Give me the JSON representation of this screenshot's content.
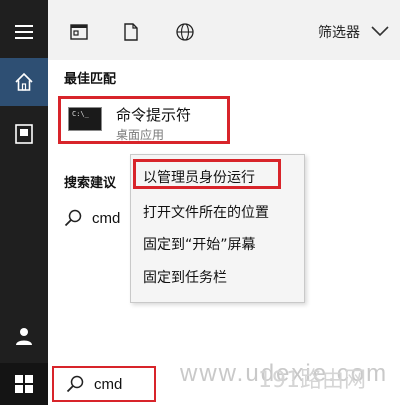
{
  "filter_bar": {
    "filter_label": "筛选器",
    "icons": [
      "apps-icon",
      "document-icon",
      "globe-icon",
      "chevron-down-icon"
    ]
  },
  "rail": {
    "icons": [
      "hamburger-menu-icon",
      "home-icon",
      "documents-icon",
      "user-icon"
    ],
    "accent": "#2e4f73"
  },
  "best_match": {
    "heading": "最佳匹配",
    "title": "命令提示符",
    "subtitle": "桌面应用",
    "icon_text": "C:\\_"
  },
  "suggestions": {
    "heading": "搜索建议",
    "items": [
      {
        "label": "cmd"
      }
    ]
  },
  "context_menu": {
    "items": [
      {
        "label": "以管理员身份运行"
      },
      {
        "label": "打开文件所在的位置"
      },
      {
        "label": "固定到“开始”屏幕"
      },
      {
        "label": "固定到任务栏"
      }
    ]
  },
  "taskbar": {
    "search_value": "cmd"
  },
  "watermark": {
    "domain": "www.udexie.com",
    "brand": "191路由网"
  },
  "colors": {
    "highlight_border": "#d8242a",
    "rail_background": "#1f1f1f",
    "filter_bar_background": "#f2f2f2"
  }
}
